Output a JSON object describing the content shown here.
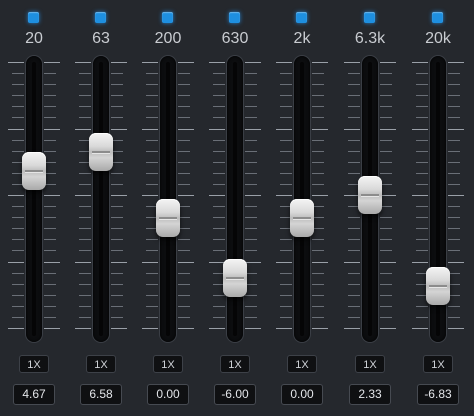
{
  "colors": {
    "background": "#25282d",
    "led": "#1e8fe0",
    "display_bg": "#0f1012"
  },
  "icons": {
    "band_indicator": "led-indicator-icon",
    "slider_knob": "fader-knob-icon"
  },
  "range": {
    "min_db": -12,
    "max_db": 12
  },
  "bands": [
    {
      "freq": "20",
      "multiplier": "1X",
      "gain_text": "4.67",
      "gain": 4.67
    },
    {
      "freq": "63",
      "multiplier": "1X",
      "gain_text": "6.58",
      "gain": 6.58
    },
    {
      "freq": "200",
      "multiplier": "1X",
      "gain_text": "0.00",
      "gain": 0.0
    },
    {
      "freq": "630",
      "multiplier": "1X",
      "gain_text": "-6.00",
      "gain": -6.0
    },
    {
      "freq": "2k",
      "multiplier": "1X",
      "gain_text": "0.00",
      "gain": 0.0
    },
    {
      "freq": "6.3k",
      "multiplier": "1X",
      "gain_text": "2.33",
      "gain": 2.33
    },
    {
      "freq": "20k",
      "multiplier": "1X",
      "gain_text": "-6.83",
      "gain": -6.83
    }
  ]
}
